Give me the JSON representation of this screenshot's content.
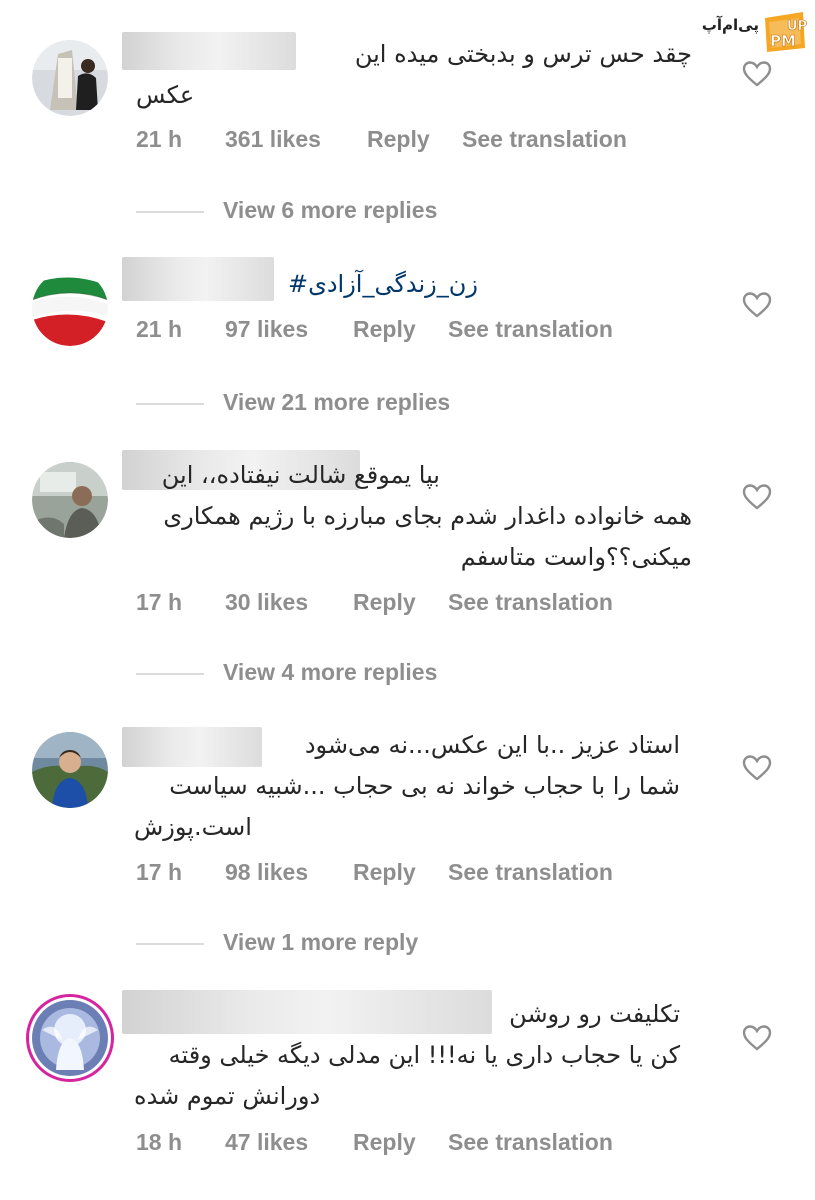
{
  "watermark": {
    "text": "پی‌ام‌آپ",
    "badge": "UP PM"
  },
  "comments": [
    {
      "lines": [
        "چقد حس ترس و بدبختی میده این",
        "عکس"
      ],
      "link": false,
      "time": "21 h",
      "likes": "361 likes",
      "reply": "Reply",
      "translate": "See translation",
      "replies": "View 6 more replies"
    },
    {
      "lines": [
        "زن_زندگی_آزادی#"
      ],
      "link": true,
      "time": "21 h",
      "likes": "97 likes",
      "reply": "Reply",
      "translate": "See translation",
      "replies": "View 21 more replies"
    },
    {
      "lines": [
        "بپا یموقع شالت نیفتاده،، این",
        "همه خانواده داغدار شدم بجای مبارزه با رژیم همکاری",
        "میکنی؟؟واست متاسفم"
      ],
      "link": false,
      "time": "17 h",
      "likes": "30 likes",
      "reply": "Reply",
      "translate": "See translation",
      "replies": "View 4 more replies"
    },
    {
      "lines": [
        "استاد عزیز ..با این عکس...نه می‌شود",
        "شما را با حجاب خواند نه بی حجاب ...شبیه سیاست",
        "است.پوزش"
      ],
      "link": false,
      "time": "17 h",
      "likes": "98 likes",
      "reply": "Reply",
      "translate": "See translation",
      "replies": "View 1 more reply"
    },
    {
      "lines": [
        "تکلیفت رو روشن",
        "کن یا حجاب داری یا نه!!! این مدلی دیگه خیلی وقته",
        "دورانش تموم شده"
      ],
      "link": false,
      "time": "18 h",
      "likes": "47 likes",
      "reply": "Reply",
      "translate": "See translation",
      "replies": ""
    }
  ]
}
